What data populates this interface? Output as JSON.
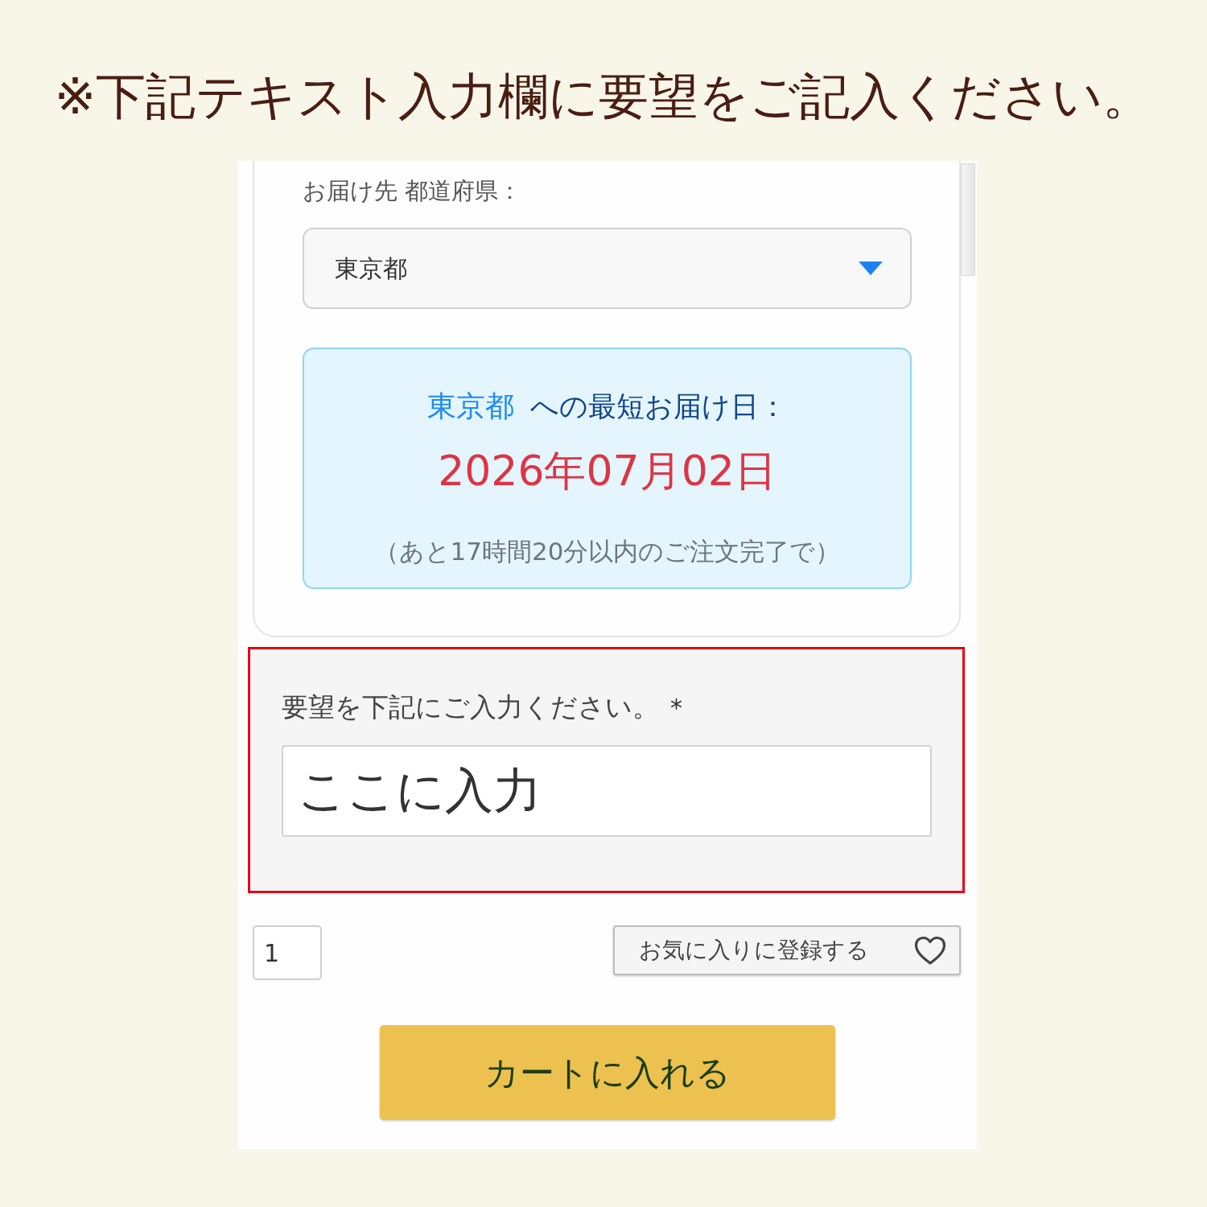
{
  "instruction": "※下記テキスト入力欄に要望をご記入ください。",
  "delivery_card": {
    "prefecture_label": "お届け先 都道府県：",
    "prefecture_select": {
      "value": "東京都"
    },
    "delivery_info": {
      "prefecture": "東京都",
      "label": "への最短お届け日：",
      "date": "2026年07月02日",
      "note": "（あと17時間20分以内のご注文完了で）"
    }
  },
  "request_field": {
    "highlighted": true,
    "label": "要望を下記にご入力ください。",
    "required_mark": "*",
    "value": "ここに入力"
  },
  "quantity": {
    "value": "1"
  },
  "favorite_button": {
    "label": "お気に入りに登録する"
  },
  "cart_button": {
    "label": "カートに入れる"
  }
}
